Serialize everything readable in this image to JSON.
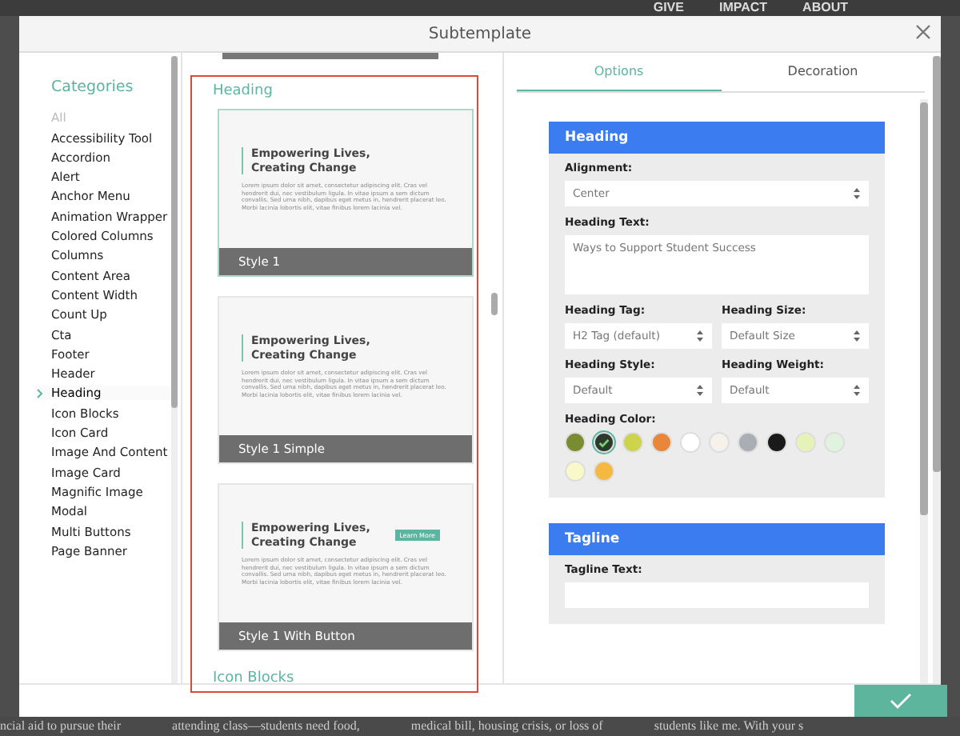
{
  "background_page": {
    "nav": [
      "GIVE",
      "IMPACT",
      "ABOUT"
    ],
    "text_fragments": [
      "ncial aid to pursue their",
      "attending class—students need food,",
      "medical bill, housing crisis, or loss of",
      "students like me. With your s"
    ]
  },
  "window": {
    "title": "Subtemplate"
  },
  "categories": {
    "title": "Categories",
    "items": [
      {
        "label": "All",
        "selected": false,
        "dimmed": true
      },
      {
        "label": "Accessibility Tool",
        "selected": false,
        "dimmed": false
      },
      {
        "label": "Accordion",
        "selected": false,
        "dimmed": false
      },
      {
        "label": "Alert",
        "selected": false,
        "dimmed": false
      },
      {
        "label": "Anchor Menu",
        "selected": false,
        "dimmed": false
      },
      {
        "label": "Animation Wrapper",
        "selected": false,
        "dimmed": false
      },
      {
        "label": "Colored Columns",
        "selected": false,
        "dimmed": false
      },
      {
        "label": "Columns",
        "selected": false,
        "dimmed": false
      },
      {
        "label": "Content Area",
        "selected": false,
        "dimmed": false
      },
      {
        "label": "Content Width",
        "selected": false,
        "dimmed": false
      },
      {
        "label": "Count Up",
        "selected": false,
        "dimmed": false
      },
      {
        "label": "Cta",
        "selected": false,
        "dimmed": false
      },
      {
        "label": "Footer",
        "selected": false,
        "dimmed": false
      },
      {
        "label": "Header",
        "selected": false,
        "dimmed": false
      },
      {
        "label": "Heading",
        "selected": true,
        "dimmed": false
      },
      {
        "label": "Icon Blocks",
        "selected": false,
        "dimmed": false
      },
      {
        "label": "Icon Card",
        "selected": false,
        "dimmed": false
      },
      {
        "label": "Image And Content",
        "selected": false,
        "dimmed": false
      },
      {
        "label": "Image Card",
        "selected": false,
        "dimmed": false
      },
      {
        "label": "Magnific Image",
        "selected": false,
        "dimmed": false
      },
      {
        "label": "Modal",
        "selected": false,
        "dimmed": false
      },
      {
        "label": "Multi Buttons",
        "selected": false,
        "dimmed": false
      },
      {
        "label": "Page Banner",
        "selected": false,
        "dimmed": false
      }
    ]
  },
  "templates": {
    "sections": [
      {
        "title": "Heading",
        "cards": [
          {
            "label": "Style 1",
            "selected": true,
            "heading": "Empowering Lives, Creating Change",
            "body": "Lorem ipsum dolor sit amet, consectetur adipiscing elit. Cras vel hendrerit dui, nec vestibulum ligula. In vitae ipsum a sem dictum convallis. Sed urna nibh, dapibus eget metus in, hendrerit placerat leo. Morbi lacinia lobortis elit, vitae finibus lorem lacinia vel."
          },
          {
            "label": "Style 1 Simple",
            "selected": false,
            "heading": "Empowering Lives, Creating Change",
            "body": "Lorem ipsum dolor sit amet, consectetur adipiscing elit. Cras vel hendrerit dui, nec vestibulum ligula. In vitae ipsum a sem dictum convallis. Sed urna nibh, dapibus eget metus in, hendrerit placerat leo. Morbi lacinia lobortis elit, vitae finibus lorem lacinia vel."
          },
          {
            "label": "Style 1 With Button",
            "selected": false,
            "heading": "Empowering Lives, Creating Change",
            "button": "Learn More",
            "body": "Lorem ipsum dolor sit amet, consectetur adipiscing elit. Cras vel hendrerit dui, nec vestibulum ligula. In vitae ipsum a sem dictum convallis. Sed urna nibh, dapibus eget metus in, hendrerit placerat leo. Morbi lacinia lobortis elit, vitae finibus lorem lacinia vel."
          }
        ]
      },
      {
        "title": "Icon Blocks"
      }
    ]
  },
  "tabs": [
    {
      "label": "Options",
      "selected": true
    },
    {
      "label": "Decoration",
      "selected": false
    }
  ],
  "panels": [
    {
      "title": "Heading",
      "rows": [
        [
          {
            "kind": "select",
            "label": "Alignment:",
            "value": "Center"
          }
        ],
        [
          {
            "kind": "textarea",
            "label": "Heading Text:",
            "value": "Ways to Support Student Success"
          }
        ],
        [
          {
            "kind": "select",
            "label": "Heading Tag:",
            "value": "H2 Tag (default)"
          },
          {
            "kind": "select",
            "label": "Heading Size:",
            "value": "Default Size"
          }
        ],
        [
          {
            "kind": "select",
            "label": "Heading Style:",
            "value": "Default"
          },
          {
            "kind": "select",
            "label": "Heading Weight:",
            "value": "Default"
          }
        ],
        [
          {
            "kind": "colors",
            "label": "Heading Color:",
            "swatches": [
              {
                "color": "#7a8c32",
                "selected": false
              },
              {
                "color": "#2c3a2e",
                "selected": true
              },
              {
                "color": "#cdd34a",
                "selected": false
              },
              {
                "color": "#e8873a",
                "selected": false
              },
              {
                "color": "#ffffff",
                "selected": false
              },
              {
                "color": "#f6f1ea",
                "selected": false
              },
              {
                "color": "#a9aeb4",
                "selected": false
              },
              {
                "color": "#1a1a1a",
                "selected": false
              },
              {
                "color": "#e6f3b8",
                "selected": false
              },
              {
                "color": "#dff3df",
                "selected": false
              },
              {
                "color": "#f8f8c8",
                "selected": false
              },
              {
                "color": "#f5b942",
                "selected": false
              }
            ]
          }
        ]
      ]
    },
    {
      "title": "Tagline",
      "rows": [
        [
          {
            "kind": "text",
            "label": "Tagline Text:"
          }
        ]
      ]
    }
  ]
}
